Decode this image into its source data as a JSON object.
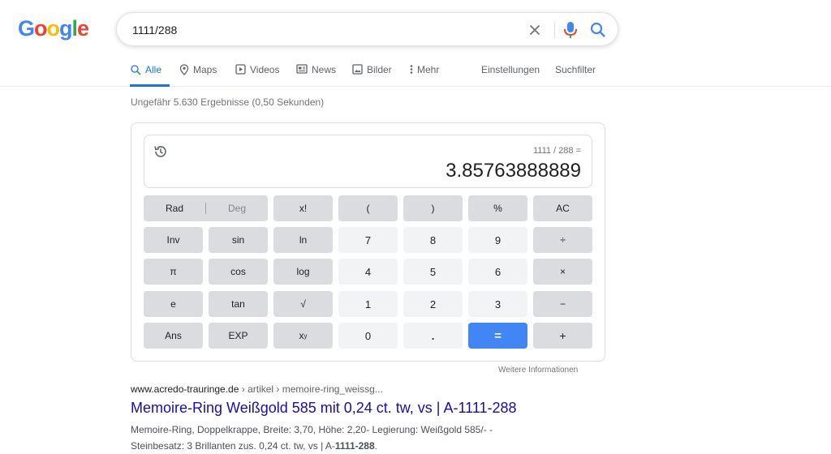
{
  "logo": {
    "letters": [
      "G",
      "o",
      "o",
      "g",
      "l",
      "e"
    ]
  },
  "search": {
    "query": "1111/288",
    "icons": [
      "close-icon",
      "microphone-icon",
      "search-icon"
    ]
  },
  "tabs": [
    {
      "label": "Alle",
      "icon": "search-icon",
      "active": true
    },
    {
      "label": "Maps",
      "icon": "map-pin-icon"
    },
    {
      "label": "Videos",
      "icon": "play-icon"
    },
    {
      "label": "News",
      "icon": "newspaper-icon"
    },
    {
      "label": "Bilder",
      "icon": "image-icon"
    },
    {
      "label": "Mehr",
      "icon": "more-vert-icon"
    }
  ],
  "tools": {
    "settings": "Einstellungen",
    "filter": "Suchfilter"
  },
  "stats": "Ungefähr 5.630 Ergebnisse (0,50 Sekunden)",
  "calculator": {
    "expression": "1111 / 288 =",
    "result": "3.85763888889",
    "rad": "Rad",
    "deg": "Deg",
    "buttons": {
      "fact": "x!",
      "lparen": "(",
      "rparen": ")",
      "percent": "%",
      "ac": "AC",
      "inv": "Inv",
      "sin": "sin",
      "ln": "ln",
      "n7": "7",
      "n8": "8",
      "n9": "9",
      "div": "÷",
      "pi": "π",
      "cos": "cos",
      "log": "log",
      "n4": "4",
      "n5": "5",
      "n6": "6",
      "mul": "×",
      "e": "e",
      "tan": "tan",
      "sqrt": "√",
      "n1": "1",
      "n2": "2",
      "n3": "3",
      "minus": "−",
      "ans": "Ans",
      "exp": "EXP",
      "n0": "0",
      "dot": ".",
      "eq": "=",
      "plus": "+"
    },
    "more_info": "Weitere Informationen"
  },
  "result": {
    "domain": "www.acredo-trauringe.de",
    "crumbs": " › artikel › memoire-ring_weissg...",
    "title": "Memoire-Ring Weißgold 585 mit 0,24 ct. tw, vs | A-1111-288",
    "snippet_line1": "Memoire-Ring, Doppelkrappe, Breite: 3,70, Höhe: 2,20- Legierung: Weißgold 585/- -",
    "snippet_line2_pre": "Steinbesatz: 3 Brillanten zus. 0,24 ct. tw, vs | A-",
    "snippet_line2_bold": "1111-288",
    "snippet_line2_post": "."
  }
}
